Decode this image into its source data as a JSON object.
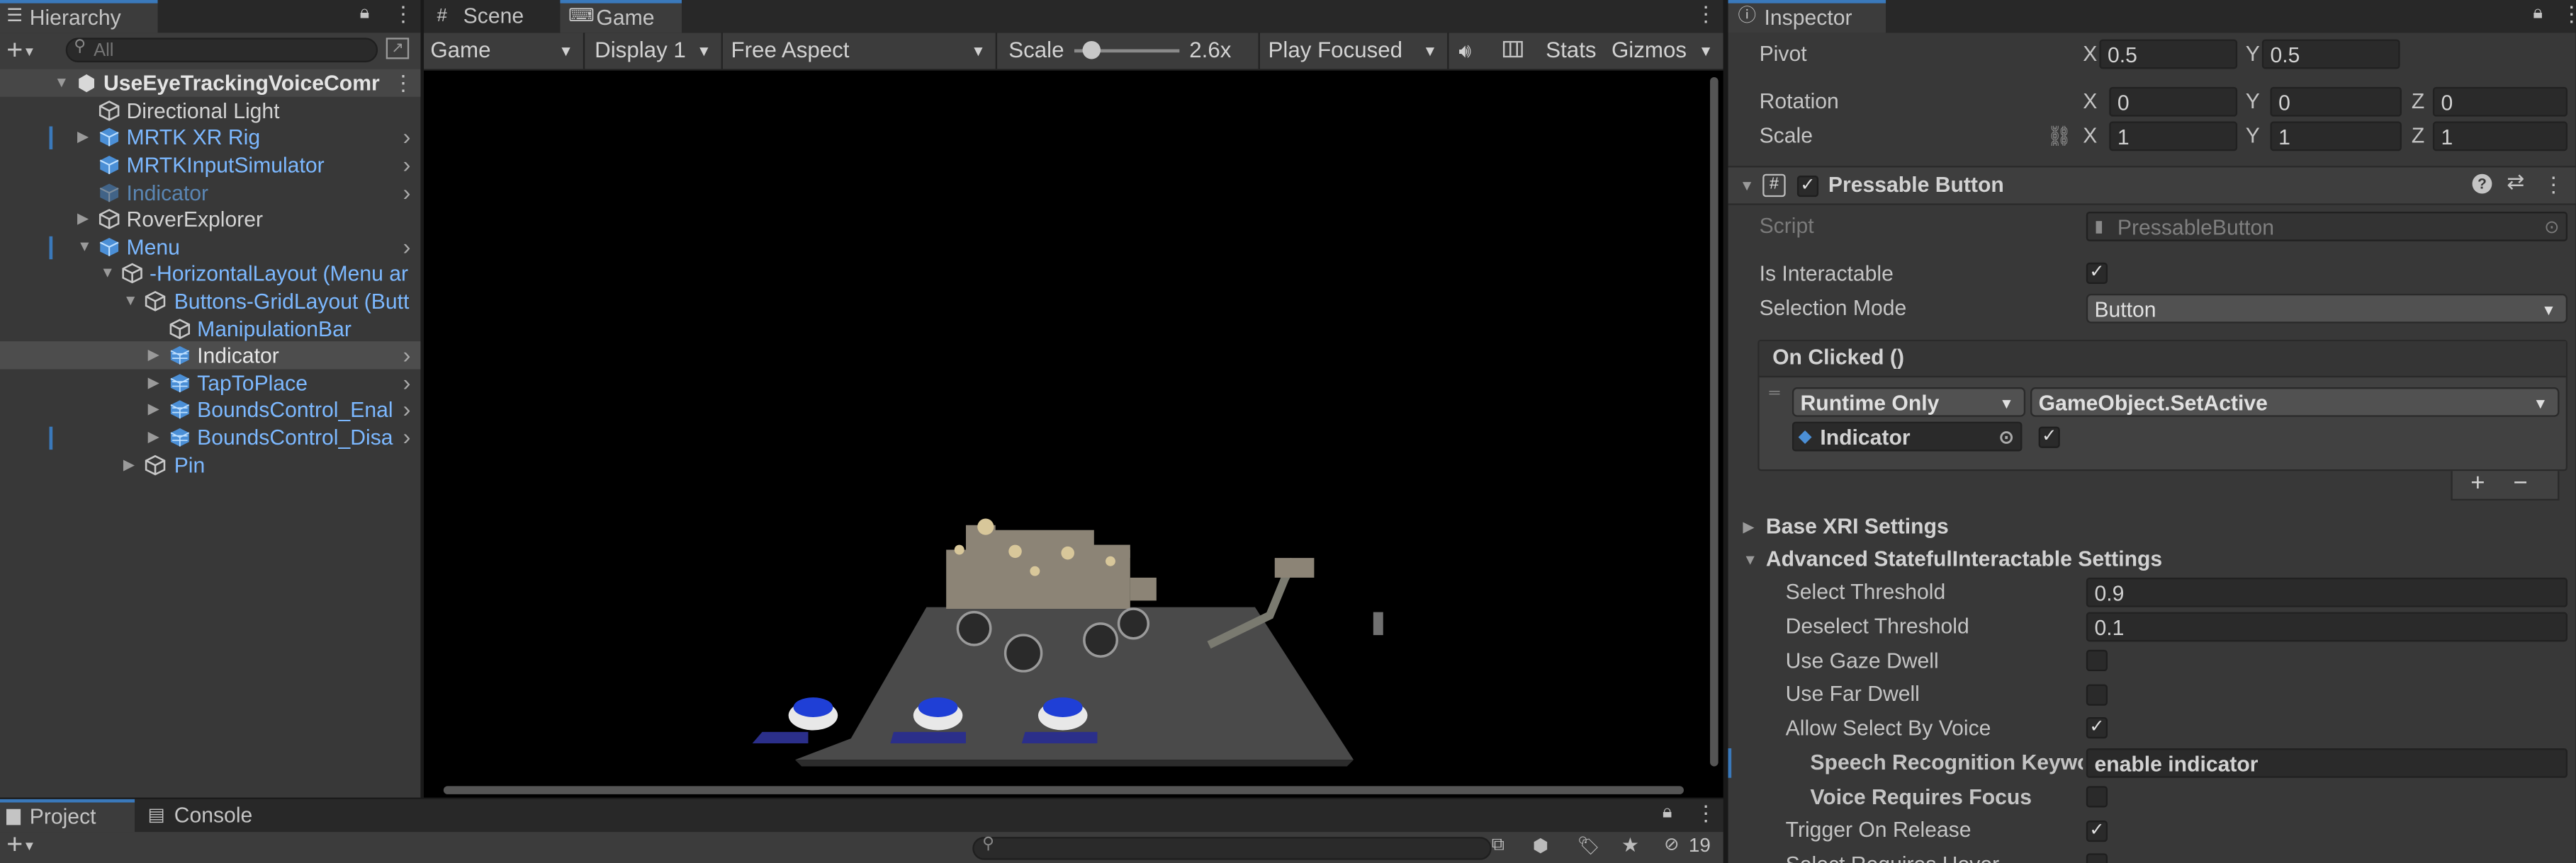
{
  "hierarchy": {
    "tab_label": "Hierarchy",
    "search_placeholder": "All",
    "rows": [
      {
        "label": "UseEyeTrackingVoiceComr",
        "style": "scene"
      },
      {
        "label": "Directional Light",
        "style": "normal"
      },
      {
        "label": "MRTK XR Rig",
        "style": "prefab"
      },
      {
        "label": "MRTKInputSimulator",
        "style": "prefab"
      },
      {
        "label": "Indicator",
        "style": "inactive"
      },
      {
        "label": "RoverExplorer",
        "style": "normal"
      },
      {
        "label": "Menu",
        "style": "prefab"
      },
      {
        "label": "-HorizontalLayout (Menu ar",
        "style": "prefab"
      },
      {
        "label": "Buttons-GridLayout (Butt",
        "style": "prefab"
      },
      {
        "label": "ManipulationBar",
        "style": "prefab"
      },
      {
        "label": "Indicator",
        "style": "prefab"
      },
      {
        "label": "TapToPlace",
        "style": "prefab"
      },
      {
        "label": "BoundsControl_Enal",
        "style": "prefab"
      },
      {
        "label": "BoundsControl_Disa",
        "style": "prefab"
      },
      {
        "label": "Pin",
        "style": "prefab"
      }
    ]
  },
  "center_tabs": {
    "scene": "Scene",
    "game": "Game"
  },
  "game_toolbar": {
    "view_mode": "Game",
    "display": "Display 1",
    "aspect": "Free Aspect",
    "scale_label": "Scale",
    "scale_value": "2.6x",
    "scale_fraction": 0.15,
    "play_mode": "Play Focused",
    "stats": "Stats",
    "gizmos": "Gizmos"
  },
  "bottom_tabs": {
    "project": "Project",
    "console": "Console",
    "hidden_count": "19"
  },
  "inspector": {
    "tab_label": "Inspector",
    "pivot": {
      "label": "Pivot",
      "x": "0.5",
      "y": "0.5"
    },
    "rotation": {
      "label": "Rotation",
      "x": "0",
      "y": "0",
      "z": "0"
    },
    "scale": {
      "label": "Scale",
      "x": "1",
      "y": "1",
      "z": "1"
    },
    "axis": {
      "x": "X",
      "y": "Y",
      "z": "Z"
    },
    "component": {
      "title": "Pressable Button",
      "script_label": "Script",
      "script_value": "PressableButton",
      "is_interactable_label": "Is Interactable",
      "is_interactable": true,
      "selection_mode_label": "Selection Mode",
      "selection_mode_value": "Button",
      "on_clicked_label": "On Clicked ()",
      "runtime_label": "Runtime Only",
      "function_label": "GameObject.SetActive",
      "target_label": "Indicator",
      "target_value": true,
      "plus": "+",
      "minus": "−"
    },
    "base_xri_label": "Base XRI Settings",
    "advanced_label": "Advanced StatefulInteractable Settings",
    "select_threshold_label": "Select Threshold",
    "select_threshold": "0.9",
    "deselect_threshold_label": "Deselect Threshold",
    "deselect_threshold": "0.1",
    "use_gaze_dwell_label": "Use Gaze Dwell",
    "use_gaze_dwell": false,
    "use_far_dwell_label": "Use Far Dwell",
    "use_far_dwell": false,
    "allow_voice_label": "Allow Select By Voice",
    "allow_voice": true,
    "speech_keyword_label": "Speech Recognition Keywo",
    "speech_keyword": "enable indicator",
    "voice_focus_label": "Voice Requires Focus",
    "voice_focus": false,
    "trigger_release_label": "Trigger On Release",
    "trigger_release": true,
    "select_hover_label": "Select Requires Hover"
  },
  "colors": {
    "accent": "#3a79bb",
    "prefab_blue": "#7cb8ff",
    "panel_bg": "#383838",
    "viewport_bg": "#000000"
  }
}
